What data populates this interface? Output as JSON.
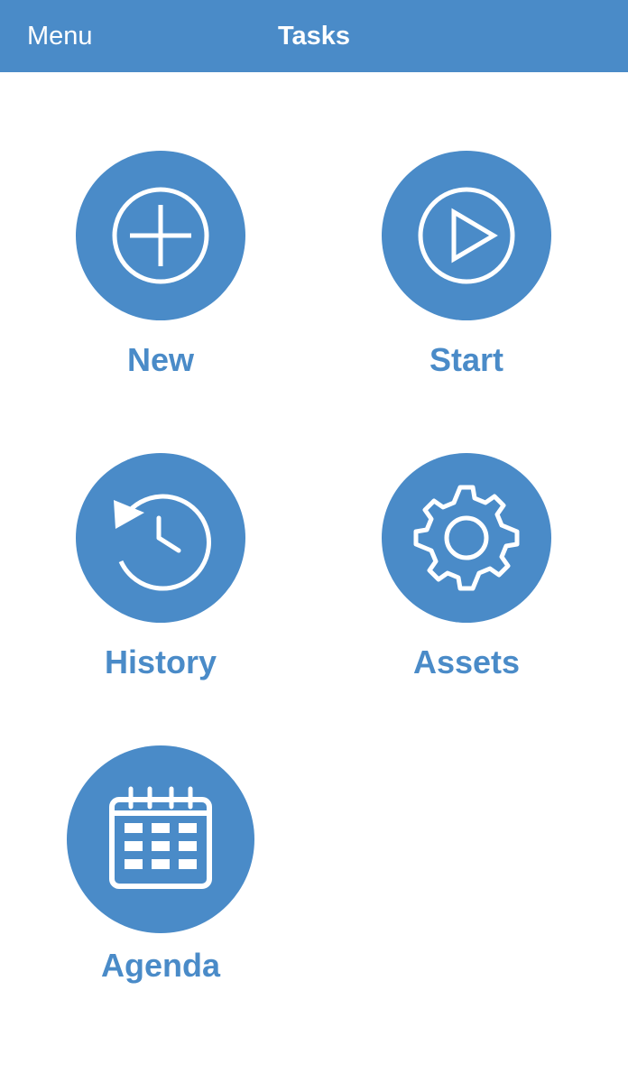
{
  "navbar": {
    "menu_label": "Menu",
    "title": "Tasks",
    "background_color": "#4a8bc8",
    "text_color": "#ffffff"
  },
  "tiles": [
    {
      "label": "New",
      "icon": "plus-circle-icon"
    },
    {
      "label": "Start",
      "icon": "play-circle-icon"
    },
    {
      "label": "History",
      "icon": "history-clock-icon"
    },
    {
      "label": "Assets",
      "icon": "gear-icon"
    },
    {
      "label": "Agenda",
      "icon": "calendar-icon"
    }
  ],
  "colors": {
    "accent": "#4a8bc8",
    "icon_stroke": "#ffffff",
    "background": "#ffffff"
  }
}
